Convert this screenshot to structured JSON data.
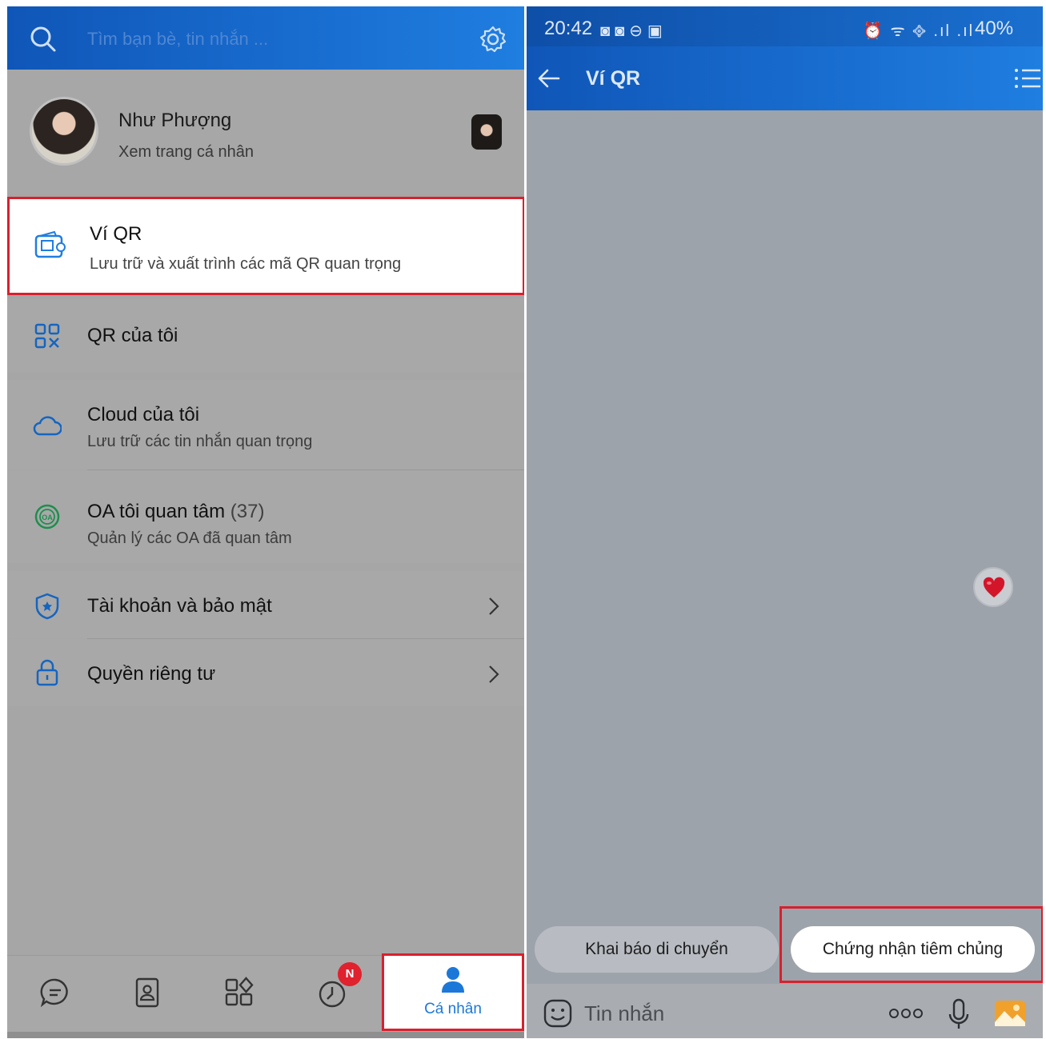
{
  "left": {
    "search": {
      "placeholder": "Tìm bạn bè, tin nhắn ..."
    },
    "profile": {
      "name": "Như Phượng",
      "subtitle": "Xem trang cá nhân"
    },
    "menu": [
      {
        "title": "Ví QR",
        "subtitle": "Lưu trữ và xuất trình các mã QR quan trọng"
      },
      {
        "title": "QR của tôi"
      },
      {
        "title": "Cloud của tôi",
        "subtitle": "Lưu trữ các tin nhắn quan trọng"
      },
      {
        "title": "OA tôi quan tâm",
        "count": "(37)",
        "subtitle": "Quản lý các OA đã quan tâm"
      },
      {
        "title": "Tài khoản và bảo mật"
      },
      {
        "title": "Quyền riêng tư"
      }
    ],
    "bottom_nav": {
      "badge": "N",
      "active_label": "Cá nhân"
    }
  },
  "right": {
    "status": {
      "time": "20:42",
      "icons": "◙◙⊖▣",
      "signal": "⏰ ᯤ ᪣ .ıl .ıl",
      "battery": "40%"
    },
    "header": {
      "title": "Ví QR"
    },
    "chips": [
      "Khai báo di chuyển",
      "Chứng nhận tiêm chủng"
    ],
    "composer": {
      "placeholder": "Tin nhắn"
    }
  },
  "colors": {
    "accent_blue": "#1f7ee0",
    "highlight_red": "#d8202d"
  }
}
